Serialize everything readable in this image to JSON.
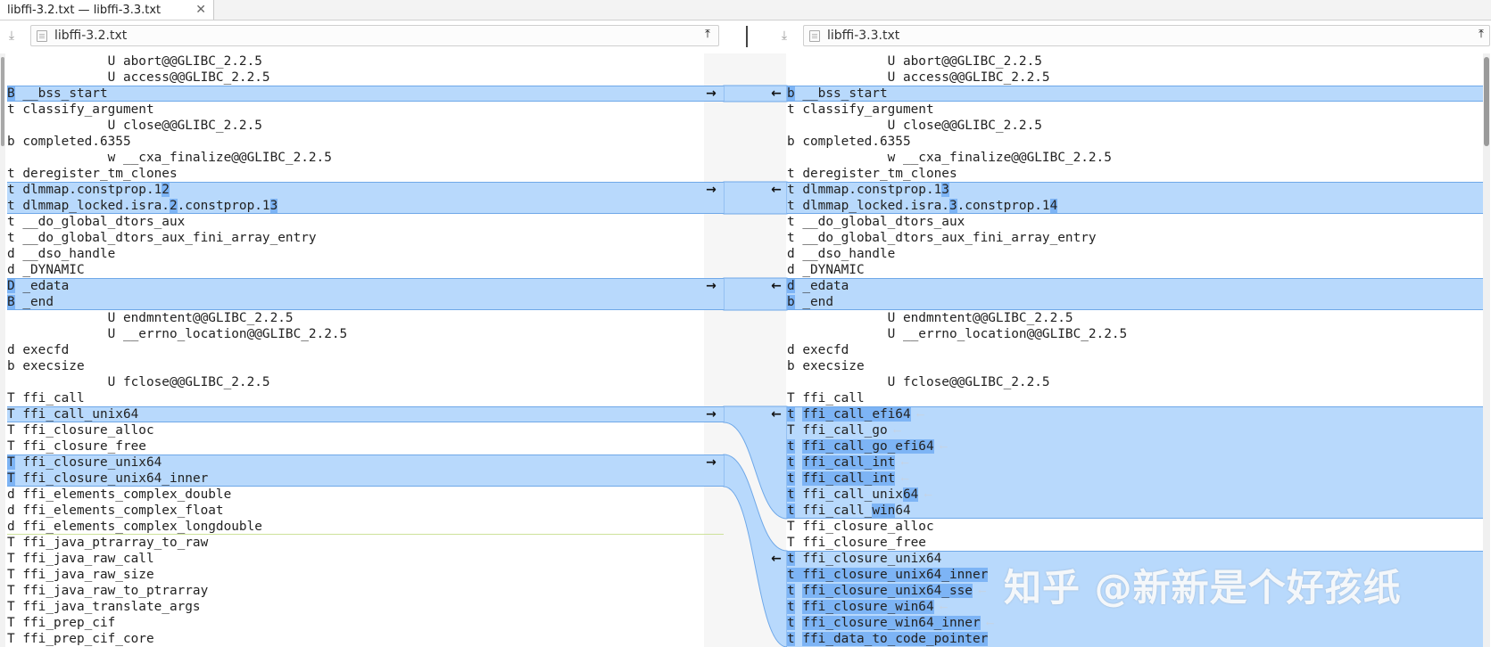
{
  "tab": {
    "title": "libffi-3.2.txt — libffi-3.3.txt",
    "close": "✕"
  },
  "files": {
    "left": "libffi-3.2.txt",
    "right": "libffi-3.3.txt"
  },
  "icons": {
    "download": "download-icon",
    "upload": "upload-icon",
    "file": "file-icon",
    "arrow_right": "→",
    "arrow_left": "←"
  },
  "colors": {
    "changed": "#b8d9fc",
    "highlight": "#7db4f5"
  },
  "left_lines": [
    {
      "segs": [
        {
          "t": "             U abort@@GLIBC_2.2.5"
        }
      ]
    },
    {
      "segs": [
        {
          "t": "             U access@@GLIBC_2.2.5"
        }
      ]
    },
    {
      "chg": true,
      "first": true,
      "last": true,
      "arrow": true,
      "segs": [
        {
          "t": "B",
          "h": true
        },
        {
          "t": " __bss_start"
        }
      ]
    },
    {
      "segs": [
        {
          "t": "t classify_argument"
        }
      ]
    },
    {
      "segs": [
        {
          "t": "             U close@@GLIBC_2.2.5"
        }
      ]
    },
    {
      "segs": [
        {
          "t": "b completed.6355"
        }
      ]
    },
    {
      "segs": [
        {
          "t": "             w __cxa_finalize@@GLIBC_2.2.5"
        }
      ]
    },
    {
      "segs": [
        {
          "t": "t deregister_tm_clones"
        }
      ]
    },
    {
      "chg": true,
      "first": true,
      "arrow": true,
      "segs": [
        {
          "t": "t dlmmap.constprop.1"
        },
        {
          "t": "2",
          "h": true
        }
      ]
    },
    {
      "chg": true,
      "last": true,
      "segs": [
        {
          "t": "t dlmmap_locked.isra."
        },
        {
          "t": "2",
          "h": true
        },
        {
          "t": ".constprop.1"
        },
        {
          "t": "3",
          "h": true
        }
      ]
    },
    {
      "segs": [
        {
          "t": "t __do_global_dtors_aux"
        }
      ]
    },
    {
      "segs": [
        {
          "t": "t __do_global_dtors_aux_fini_array_entry"
        }
      ]
    },
    {
      "segs": [
        {
          "t": "d __dso_handle"
        }
      ]
    },
    {
      "segs": [
        {
          "t": "d _DYNAMIC"
        }
      ]
    },
    {
      "chg": true,
      "first": true,
      "arrow": true,
      "segs": [
        {
          "t": "D",
          "h": true
        },
        {
          "t": " _edata"
        }
      ]
    },
    {
      "chg": true,
      "last": true,
      "segs": [
        {
          "t": "B",
          "h": true
        },
        {
          "t": " _end"
        }
      ]
    },
    {
      "segs": [
        {
          "t": "             U endmntent@@GLIBC_2.2.5"
        }
      ]
    },
    {
      "segs": [
        {
          "t": "             U __errno_location@@GLIBC_2.2.5"
        }
      ]
    },
    {
      "segs": [
        {
          "t": "d execfd"
        }
      ]
    },
    {
      "segs": [
        {
          "t": "b execsize"
        }
      ]
    },
    {
      "segs": [
        {
          "t": "             U fclose@@GLIBC_2.2.5"
        }
      ]
    },
    {
      "segs": [
        {
          "t": "T ffi_call"
        }
      ]
    },
    {
      "chg": true,
      "first": true,
      "last": true,
      "arrow": true,
      "segs": [
        {
          "t": "T ffi_call_unix64"
        }
      ]
    },
    {
      "segs": [
        {
          "t": "T ffi_closure_alloc"
        }
      ]
    },
    {
      "segs": [
        {
          "t": "T ffi_closure_free"
        }
      ]
    },
    {
      "chg": true,
      "first": true,
      "arrow": true,
      "segs": [
        {
          "t": "T",
          "h": true
        },
        {
          "t": " ffi_closure_unix64"
        }
      ]
    },
    {
      "chg": true,
      "last": true,
      "segs": [
        {
          "t": "T",
          "h": true
        },
        {
          "t": " ffi_closure_unix64_inner"
        }
      ]
    },
    {
      "segs": [
        {
          "t": "d ffi_elements_complex_double"
        }
      ]
    },
    {
      "segs": [
        {
          "t": "d ffi_elements_complex_float"
        }
      ]
    },
    {
      "sep": true,
      "segs": [
        {
          "t": "d ffi_elements_complex_longdouble"
        }
      ]
    },
    {
      "segs": [
        {
          "t": "T ffi_java_ptrarray_to_raw"
        }
      ]
    },
    {
      "segs": [
        {
          "t": "T ffi_java_raw_call"
        }
      ]
    },
    {
      "segs": [
        {
          "t": "T ffi_java_raw_size"
        }
      ]
    },
    {
      "segs": [
        {
          "t": "T ffi_java_raw_to_ptrarray"
        }
      ]
    },
    {
      "segs": [
        {
          "t": "T ffi_java_translate_args"
        }
      ]
    },
    {
      "segs": [
        {
          "t": "T ffi_prep_cif"
        }
      ]
    },
    {
      "segs": [
        {
          "t": "T ffi_prep_cif_core"
        }
      ]
    }
  ],
  "right_lines": [
    {
      "segs": [
        {
          "t": "             U abort@@GLIBC_2.2.5"
        }
      ]
    },
    {
      "segs": [
        {
          "t": "             U access@@GLIBC_2.2.5"
        }
      ]
    },
    {
      "chg": true,
      "first": true,
      "last": true,
      "arrow": true,
      "segs": [
        {
          "t": "b",
          "h": true
        },
        {
          "t": " __bss_start"
        }
      ]
    },
    {
      "segs": [
        {
          "t": "t classify_argument"
        }
      ]
    },
    {
      "segs": [
        {
          "t": "             U close@@GLIBC_2.2.5"
        }
      ]
    },
    {
      "segs": [
        {
          "t": "b completed.6355"
        }
      ]
    },
    {
      "segs": [
        {
          "t": "             w __cxa_finalize@@GLIBC_2.2.5"
        }
      ]
    },
    {
      "segs": [
        {
          "t": "t deregister_tm_clones"
        }
      ]
    },
    {
      "chg": true,
      "first": true,
      "arrow": true,
      "segs": [
        {
          "t": "t dlmmap.constprop.1"
        },
        {
          "t": "3",
          "h": true
        }
      ]
    },
    {
      "chg": true,
      "last": true,
      "segs": [
        {
          "t": "t dlmmap_locked.isra."
        },
        {
          "t": "3",
          "h": true
        },
        {
          "t": ".constprop.1"
        },
        {
          "t": "4",
          "h": true
        }
      ]
    },
    {
      "segs": [
        {
          "t": "t __do_global_dtors_aux"
        }
      ]
    },
    {
      "segs": [
        {
          "t": "t __do_global_dtors_aux_fini_array_entry"
        }
      ]
    },
    {
      "segs": [
        {
          "t": "d __dso_handle"
        }
      ]
    },
    {
      "segs": [
        {
          "t": "d _DYNAMIC"
        }
      ]
    },
    {
      "chg": true,
      "first": true,
      "arrow": true,
      "segs": [
        {
          "t": "d",
          "h": true
        },
        {
          "t": " _edata"
        }
      ]
    },
    {
      "chg": true,
      "last": true,
      "segs": [
        {
          "t": "b",
          "h": true
        },
        {
          "t": " _end"
        }
      ]
    },
    {
      "segs": [
        {
          "t": "             U endmntent@@GLIBC_2.2.5"
        }
      ]
    },
    {
      "segs": [
        {
          "t": "             U __errno_location@@GLIBC_2.2.5"
        }
      ]
    },
    {
      "segs": [
        {
          "t": "d execfd"
        }
      ]
    },
    {
      "segs": [
        {
          "t": "b execsize"
        }
      ]
    },
    {
      "segs": [
        {
          "t": "             U fclose@@GLIBC_2.2.5"
        }
      ]
    },
    {
      "segs": [
        {
          "t": "T ffi_call"
        }
      ]
    },
    {
      "chg": true,
      "first": true,
      "arrow": true,
      "segs": [
        {
          "t": "t",
          "h": true
        },
        {
          "t": " "
        },
        {
          "t": "ffi_call_efi64",
          "h": true
        },
        {
          "t": " ⟵",
          "g": true
        }
      ]
    },
    {
      "chg": true,
      "segs": [
        {
          "t": "T ffi_call_go",
          "h2": true
        },
        {
          "t": " ⟵",
          "g": true
        }
      ]
    },
    {
      "chg": true,
      "segs": [
        {
          "t": "t",
          "h": true
        },
        {
          "t": " "
        },
        {
          "t": "ffi_call_go_efi64",
          "h": true
        },
        {
          "t": " ⟵",
          "g": true
        }
      ]
    },
    {
      "chg": true,
      "segs": [
        {
          "t": "t",
          "h": true
        },
        {
          "t": " "
        },
        {
          "t": "ffi_call_int",
          "h": true
        },
        {
          "t": " ⟵",
          "g": true
        }
      ]
    },
    {
      "chg": true,
      "segs": [
        {
          "t": "t",
          "h": true
        },
        {
          "t": " "
        },
        {
          "t": "ffi_call_int",
          "h": true
        },
        {
          "t": " ⟵",
          "g": true
        }
      ]
    },
    {
      "chg": true,
      "segs": [
        {
          "t": "t",
          "h": true
        },
        {
          "t": " ffi_call_unix"
        },
        {
          "t": "64",
          "h": true
        },
        {
          "t": " ⟵",
          "g": true
        }
      ]
    },
    {
      "chg": true,
      "last": true,
      "segs": [
        {
          "t": "t",
          "h": true
        },
        {
          "t": " ffi_call_"
        },
        {
          "t": "win",
          "h": true
        },
        {
          "t": "64"
        }
      ]
    },
    {
      "segs": [
        {
          "t": "T ffi_closure_alloc"
        }
      ]
    },
    {
      "segs": [
        {
          "t": "T ffi_closure_free"
        }
      ]
    },
    {
      "chg": true,
      "first": true,
      "arrow": true,
      "segs": [
        {
          "t": "t",
          "h": true
        },
        {
          "t": " ffi_closure_unix64"
        }
      ]
    },
    {
      "chg": true,
      "segs": [
        {
          "t": "t",
          "h": true
        },
        {
          "t": " ffi_closure_unix64_inner",
          "h": true
        }
      ]
    },
    {
      "chg": true,
      "segs": [
        {
          "t": "t",
          "h": true
        },
        {
          "t": " "
        },
        {
          "t": "ffi_closure_unix64_sse",
          "h": true
        },
        {
          "t": " ⟵",
          "g": true
        }
      ]
    },
    {
      "chg": true,
      "segs": [
        {
          "t": "t",
          "h": true
        },
        {
          "t": " "
        },
        {
          "t": "ffi_closure_win64",
          "h": true
        },
        {
          "t": " ⟵",
          "g": true
        }
      ]
    },
    {
      "chg": true,
      "segs": [
        {
          "t": "t",
          "h": true
        },
        {
          "t": " "
        },
        {
          "t": "ffi_closure_win64_inner",
          "h": true
        },
        {
          "t": " ⟵",
          "g": true
        }
      ]
    },
    {
      "chg": true,
      "segs": [
        {
          "t": "t",
          "h": true
        },
        {
          "t": " "
        },
        {
          "t": "ffi_data_to_code_pointer",
          "h": true
        }
      ]
    }
  ],
  "watermark": "知乎 @新新是个好孩纸"
}
